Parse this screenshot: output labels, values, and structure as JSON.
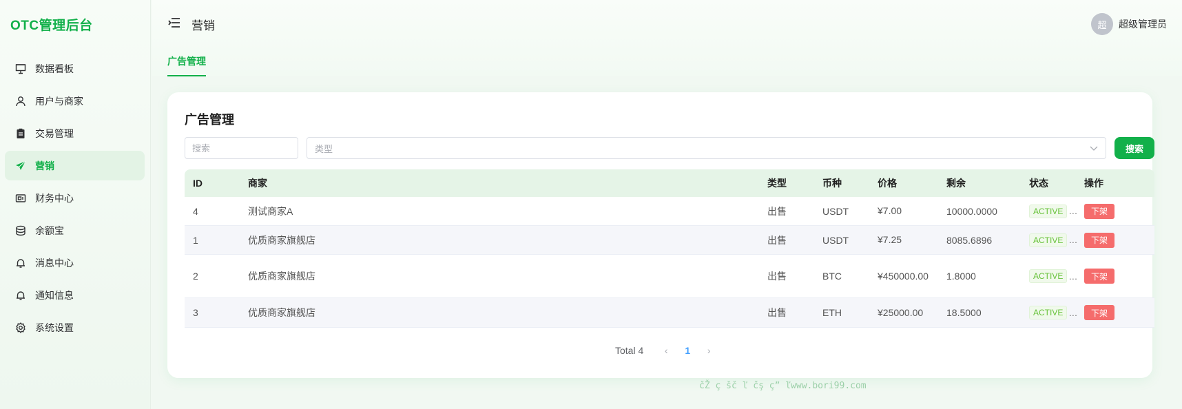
{
  "brand": "OTC管理后台",
  "sidebar": {
    "items": [
      {
        "label": "数据看板",
        "icon": "dashboard-icon"
      },
      {
        "label": "用户与商家",
        "icon": "user-icon"
      },
      {
        "label": "交易管理",
        "icon": "clipboard-icon"
      },
      {
        "label": "营销",
        "icon": "send-icon",
        "active": true
      },
      {
        "label": "财务中心",
        "icon": "finance-icon"
      },
      {
        "label": "余额宝",
        "icon": "coins-icon"
      },
      {
        "label": "消息中心",
        "icon": "bell-icon"
      },
      {
        "label": "通知信息",
        "icon": "bell-icon"
      },
      {
        "label": "系统设置",
        "icon": "gear-icon"
      }
    ]
  },
  "header": {
    "title": "营销",
    "tab": "广告管理",
    "user": {
      "avatar": "超",
      "name": "超级管理员"
    }
  },
  "card": {
    "title": "广告管理",
    "search_placeholder": "搜索",
    "type_placeholder": "类型",
    "search_button": "搜索"
  },
  "table": {
    "headers": [
      "ID",
      "商家",
      "类型",
      "币种",
      "价格",
      "剩余",
      "状态",
      "操作"
    ],
    "rows": [
      {
        "id": "4",
        "merchant": "测试商家A",
        "type": "出售",
        "coin": "USDT",
        "price": "¥7.00",
        "remaining": "10000.0000",
        "status": "ACTIVE",
        "action": "下架"
      },
      {
        "id": "1",
        "merchant": "优质商家旗舰店",
        "type": "出售",
        "coin": "USDT",
        "price": "¥7.25",
        "remaining": "8085.6896",
        "status": "ACTIVE",
        "action": "下架"
      },
      {
        "id": "2",
        "merchant": "优质商家旗舰店",
        "type": "出售",
        "coin": "BTC",
        "price": "¥450000.00",
        "remaining": "1.8000",
        "status": "ACTIVE",
        "action": "下架"
      },
      {
        "id": "3",
        "merchant": "优质商家旗舰店",
        "type": "出售",
        "coin": "ETH",
        "price": "¥25000.00",
        "remaining": "18.5000",
        "status": "ACTIVE",
        "action": "下架"
      }
    ]
  },
  "pagination": {
    "total": "Total 4",
    "current": "1"
  },
  "watermark": "čŽ ç šč ľ čş ç” ľwww.bori99.com",
  "colors": {
    "accent": "#12b04a",
    "danger": "#f56c6c",
    "status_ok": "#67c23a",
    "link": "#409eff"
  }
}
